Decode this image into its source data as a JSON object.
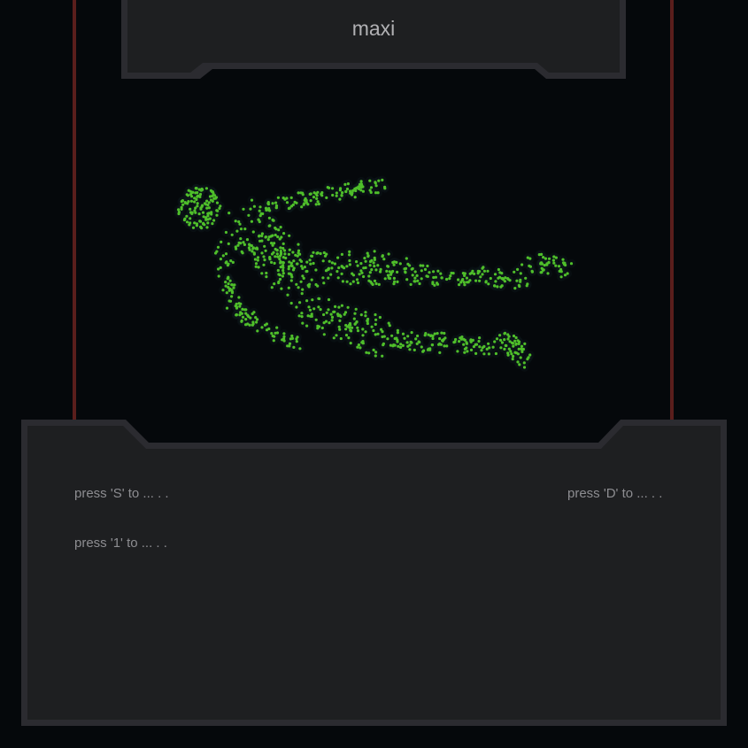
{
  "header": {
    "title": "maxi"
  },
  "controls": {
    "hint_s": "press 'S' to ... .  .",
    "hint_d": "press 'D' to ... .  .",
    "hint_1": "press '1' to ... .  ."
  },
  "colors": {
    "background": "#05080b",
    "panel": "#1e1f21",
    "panel_border": "#2b2b30",
    "rail": "#5a1e1c",
    "particle": "#4fbf2a"
  }
}
